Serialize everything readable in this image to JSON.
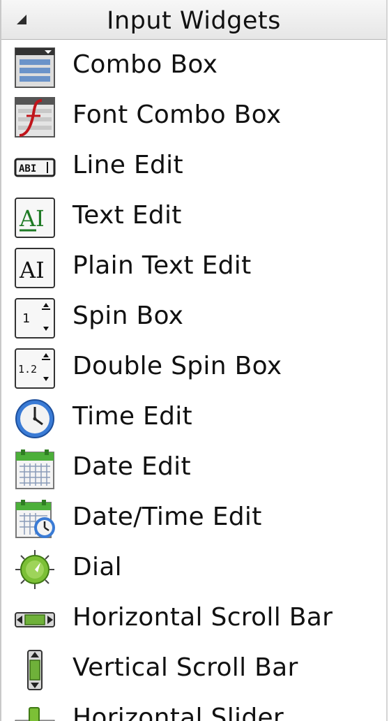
{
  "panel": {
    "title": "Input Widgets",
    "collapse_icon": "collapse-triangle-icon"
  },
  "items": [
    {
      "label": "Combo Box",
      "icon": "combo-box-icon"
    },
    {
      "label": "Font Combo Box",
      "icon": "font-combo-box-icon"
    },
    {
      "label": "Line Edit",
      "icon": "line-edit-icon"
    },
    {
      "label": "Text Edit",
      "icon": "text-edit-icon"
    },
    {
      "label": "Plain Text Edit",
      "icon": "plain-text-edit-icon"
    },
    {
      "label": "Spin Box",
      "icon": "spin-box-icon"
    },
    {
      "label": "Double Spin Box",
      "icon": "double-spin-box-icon"
    },
    {
      "label": "Time Edit",
      "icon": "time-edit-icon"
    },
    {
      "label": "Date Edit",
      "icon": "date-edit-icon"
    },
    {
      "label": "Date/Time Edit",
      "icon": "date-time-edit-icon"
    },
    {
      "label": "Dial",
      "icon": "dial-icon"
    },
    {
      "label": "Horizontal Scroll Bar",
      "icon": "horizontal-scroll-bar-icon"
    },
    {
      "label": "Vertical Scroll Bar",
      "icon": "vertical-scroll-bar-icon"
    },
    {
      "label": "Horizontal Slider",
      "icon": "horizontal-slider-icon"
    }
  ],
  "icon_text": {
    "line_edit": "ABI",
    "text_edit": "AI",
    "spin": "1",
    "double_spin": "1.2"
  }
}
